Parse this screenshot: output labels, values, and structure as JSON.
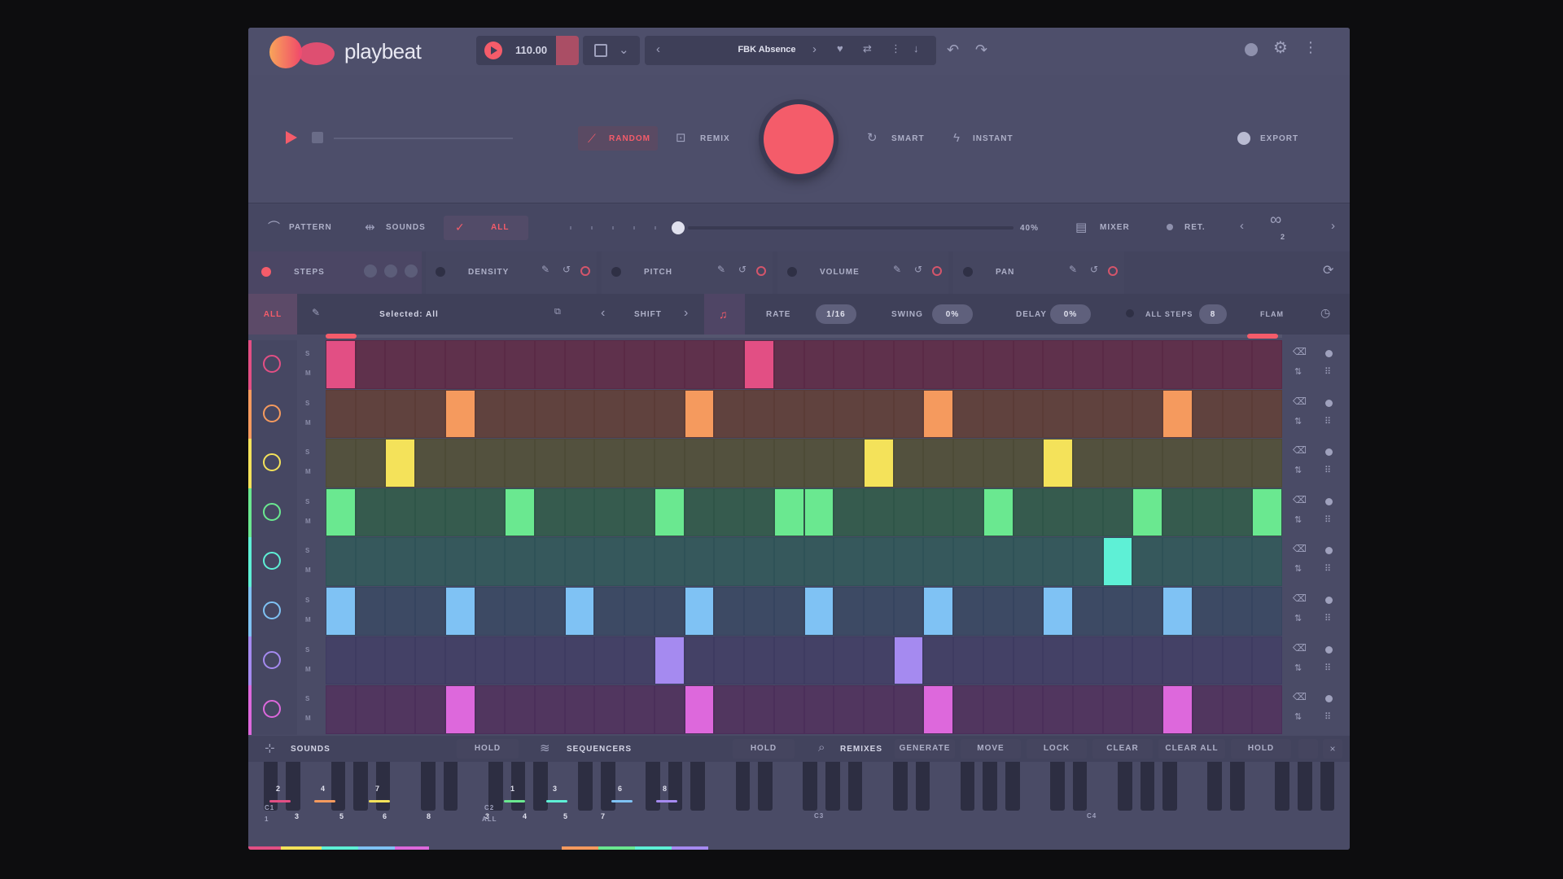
{
  "app": {
    "name": "playbeat"
  },
  "header": {
    "tempo": "110.00",
    "preset_name": "FBK Absence"
  },
  "transport": {
    "random_label": "RANDOM",
    "remix_label": "REMIX",
    "smart_label": "SMART",
    "instant_label": "INSTANT",
    "export_label": "EXPORT"
  },
  "modes": {
    "pattern_label": "PATTERN",
    "sounds_label": "SOUNDS",
    "all_label": "ALL",
    "percent": "40%",
    "mixer_label": "MIXER",
    "ret_label": "RET.",
    "page_number": "2"
  },
  "params": {
    "steps_label": "STEPS",
    "density_label": "DENSITY",
    "pitch_label": "PITCH",
    "volume_label": "VOLUME",
    "pan_label": "PAN"
  },
  "editor": {
    "all_tab": "ALL",
    "selected_label": "Selected: All",
    "shift_label": "SHIFT",
    "rate_label": "RATE",
    "rate_value": "1/16",
    "swing_label": "SWING",
    "swing_value": "0%",
    "delay_label": "DELAY",
    "delay_value": "0%",
    "all_steps_label": "ALL STEPS",
    "all_steps_value": "8",
    "flam_label": "FLAM"
  },
  "lanes": [
    {
      "icon": "kick-drum-icon",
      "color": "#e24f84",
      "bg": "#5a2a46",
      "steps": [
        0,
        14
      ]
    },
    {
      "icon": "snare-icon",
      "color": "#f59a5e",
      "bg": "#5b3c37",
      "steps": [
        4,
        12,
        20,
        28
      ]
    },
    {
      "icon": "hihat-icon",
      "color": "#f4e25a",
      "bg": "#4d4b37",
      "steps": [
        2,
        18,
        24
      ]
    },
    {
      "icon": "cymbal-icon",
      "color": "#6ae890",
      "bg": "#2f5548",
      "steps": [
        0,
        6,
        11,
        15,
        16,
        22,
        27,
        31
      ]
    },
    {
      "icon": "tom-icon",
      "color": "#5ef0d6",
      "bg": "#2f5257",
      "steps": [
        26
      ]
    },
    {
      "icon": "drum-icon",
      "color": "#7fc2f4",
      "bg": "#36445f",
      "steps": [
        0,
        4,
        8,
        12,
        16,
        20,
        24,
        28
      ]
    },
    {
      "icon": "wave-icon",
      "color": "#a58af0",
      "bg": "#3e3b61",
      "steps": [
        11,
        19
      ]
    },
    {
      "icon": "sparkle-icon",
      "color": "#dd68dc",
      "bg": "#4b2f5a",
      "steps": [
        4,
        12,
        20,
        28
      ]
    }
  ],
  "lane_side": {
    "s": "S",
    "m": "M"
  },
  "bottom": {
    "sounds_label": "SOUNDS",
    "hold1": "HOLD",
    "sequencers_label": "SEQUENCERS",
    "hold2": "HOLD",
    "remixes_label": "REMIXES",
    "generate": "GENERATE",
    "move": "MOVE",
    "lock": "LOCK",
    "clear": "CLEAR",
    "clear_all": "CLEAR ALL",
    "hold3": "HOLD",
    "c2": "C2",
    "all": "ALL",
    "c3": "C3",
    "c4": "C4",
    "c1": "C1",
    "one": "1"
  },
  "keys_top": [
    "2",
    "4",
    "7",
    "1",
    "3",
    "6",
    "8"
  ],
  "keys_bottom": [
    "3",
    "5",
    "6",
    "8",
    "3",
    "4",
    "5",
    "7"
  ],
  "colors": {
    "accent": "#f45c6a",
    "panel": "#4a4b66"
  }
}
